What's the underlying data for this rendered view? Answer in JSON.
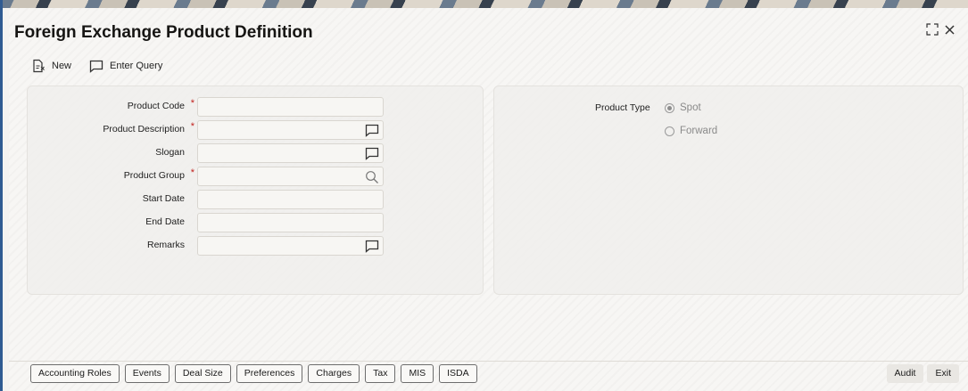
{
  "window": {
    "title": "Foreign Exchange Product Definition",
    "controls": {
      "expand_glyph": "⁜",
      "close_glyph": "✕"
    }
  },
  "toolbar": {
    "new_label": "New",
    "enter_query_label": "Enter Query"
  },
  "form": {
    "required_mark": "*",
    "fields": [
      {
        "label": "Product Code",
        "required": true,
        "value": "",
        "icon": null
      },
      {
        "label": "Product Description",
        "required": true,
        "value": "",
        "icon": "comment-icon"
      },
      {
        "label": "Slogan",
        "required": false,
        "value": "",
        "icon": "comment-icon"
      },
      {
        "label": "Product Group",
        "required": true,
        "value": "",
        "icon": "search-icon"
      },
      {
        "label": "Start Date",
        "required": false,
        "value": "",
        "icon": null
      },
      {
        "label": "End Date",
        "required": false,
        "value": "",
        "icon": null
      },
      {
        "label": "Remarks",
        "required": false,
        "value": "",
        "icon": "comment-icon"
      }
    ]
  },
  "product_type": {
    "label": "Product Type",
    "options": [
      {
        "label": "Spot",
        "selected": true
      },
      {
        "label": "Forward",
        "selected": false
      }
    ]
  },
  "tabs": [
    "Accounting Roles",
    "Events",
    "Deal Size",
    "Preferences",
    "Charges",
    "Tax",
    "MIS",
    "ISDA"
  ],
  "footer": {
    "audit_label": "Audit",
    "exit_label": "Exit"
  },
  "colors": {
    "required": "#c2211d",
    "accent": "#2f5b92"
  }
}
